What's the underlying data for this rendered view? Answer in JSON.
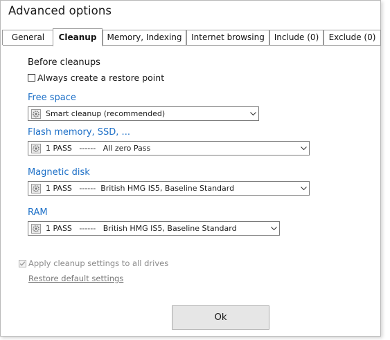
{
  "window": {
    "title": "Advanced options"
  },
  "tabs": [
    {
      "label": "General"
    },
    {
      "label": "Cleanup",
      "active": true
    },
    {
      "label": "Memory, Indexing"
    },
    {
      "label": "Internet browsing"
    },
    {
      "label": "Include (0)"
    },
    {
      "label": "Exclude (0)"
    }
  ],
  "before_cleanups": {
    "heading": "Before cleanups",
    "restore_point_label": "Always create a restore point",
    "restore_point_checked": false
  },
  "free_space": {
    "label": "Free space",
    "selected": "Smart cleanup (recommended)"
  },
  "flash_memory": {
    "label": "Flash memory, SSD, ...",
    "selected": "1 PASS   ------   All zero Pass"
  },
  "magnetic_disk": {
    "label": "Magnetic disk",
    "selected": "1 PASS   ------  British HMG IS5, Baseline Standard"
  },
  "ram": {
    "label": "RAM",
    "selected": "1 PASS   ------   British HMG IS5, Baseline Standard"
  },
  "apply_all": {
    "label": "Apply cleanup settings to all drives",
    "checked": true,
    "disabled": true
  },
  "restore_default": {
    "label": "Restore default settings"
  },
  "ok_button": {
    "label": "Ok"
  },
  "colors": {
    "accent_blue": "#1c6fc7",
    "disabled_gray": "#8a8a8a",
    "button_bg": "#e6e6e6"
  },
  "icons": {
    "select_icon": "gear-icon",
    "select_arrow": "chevron-down-icon",
    "check_mark": "check-icon"
  }
}
